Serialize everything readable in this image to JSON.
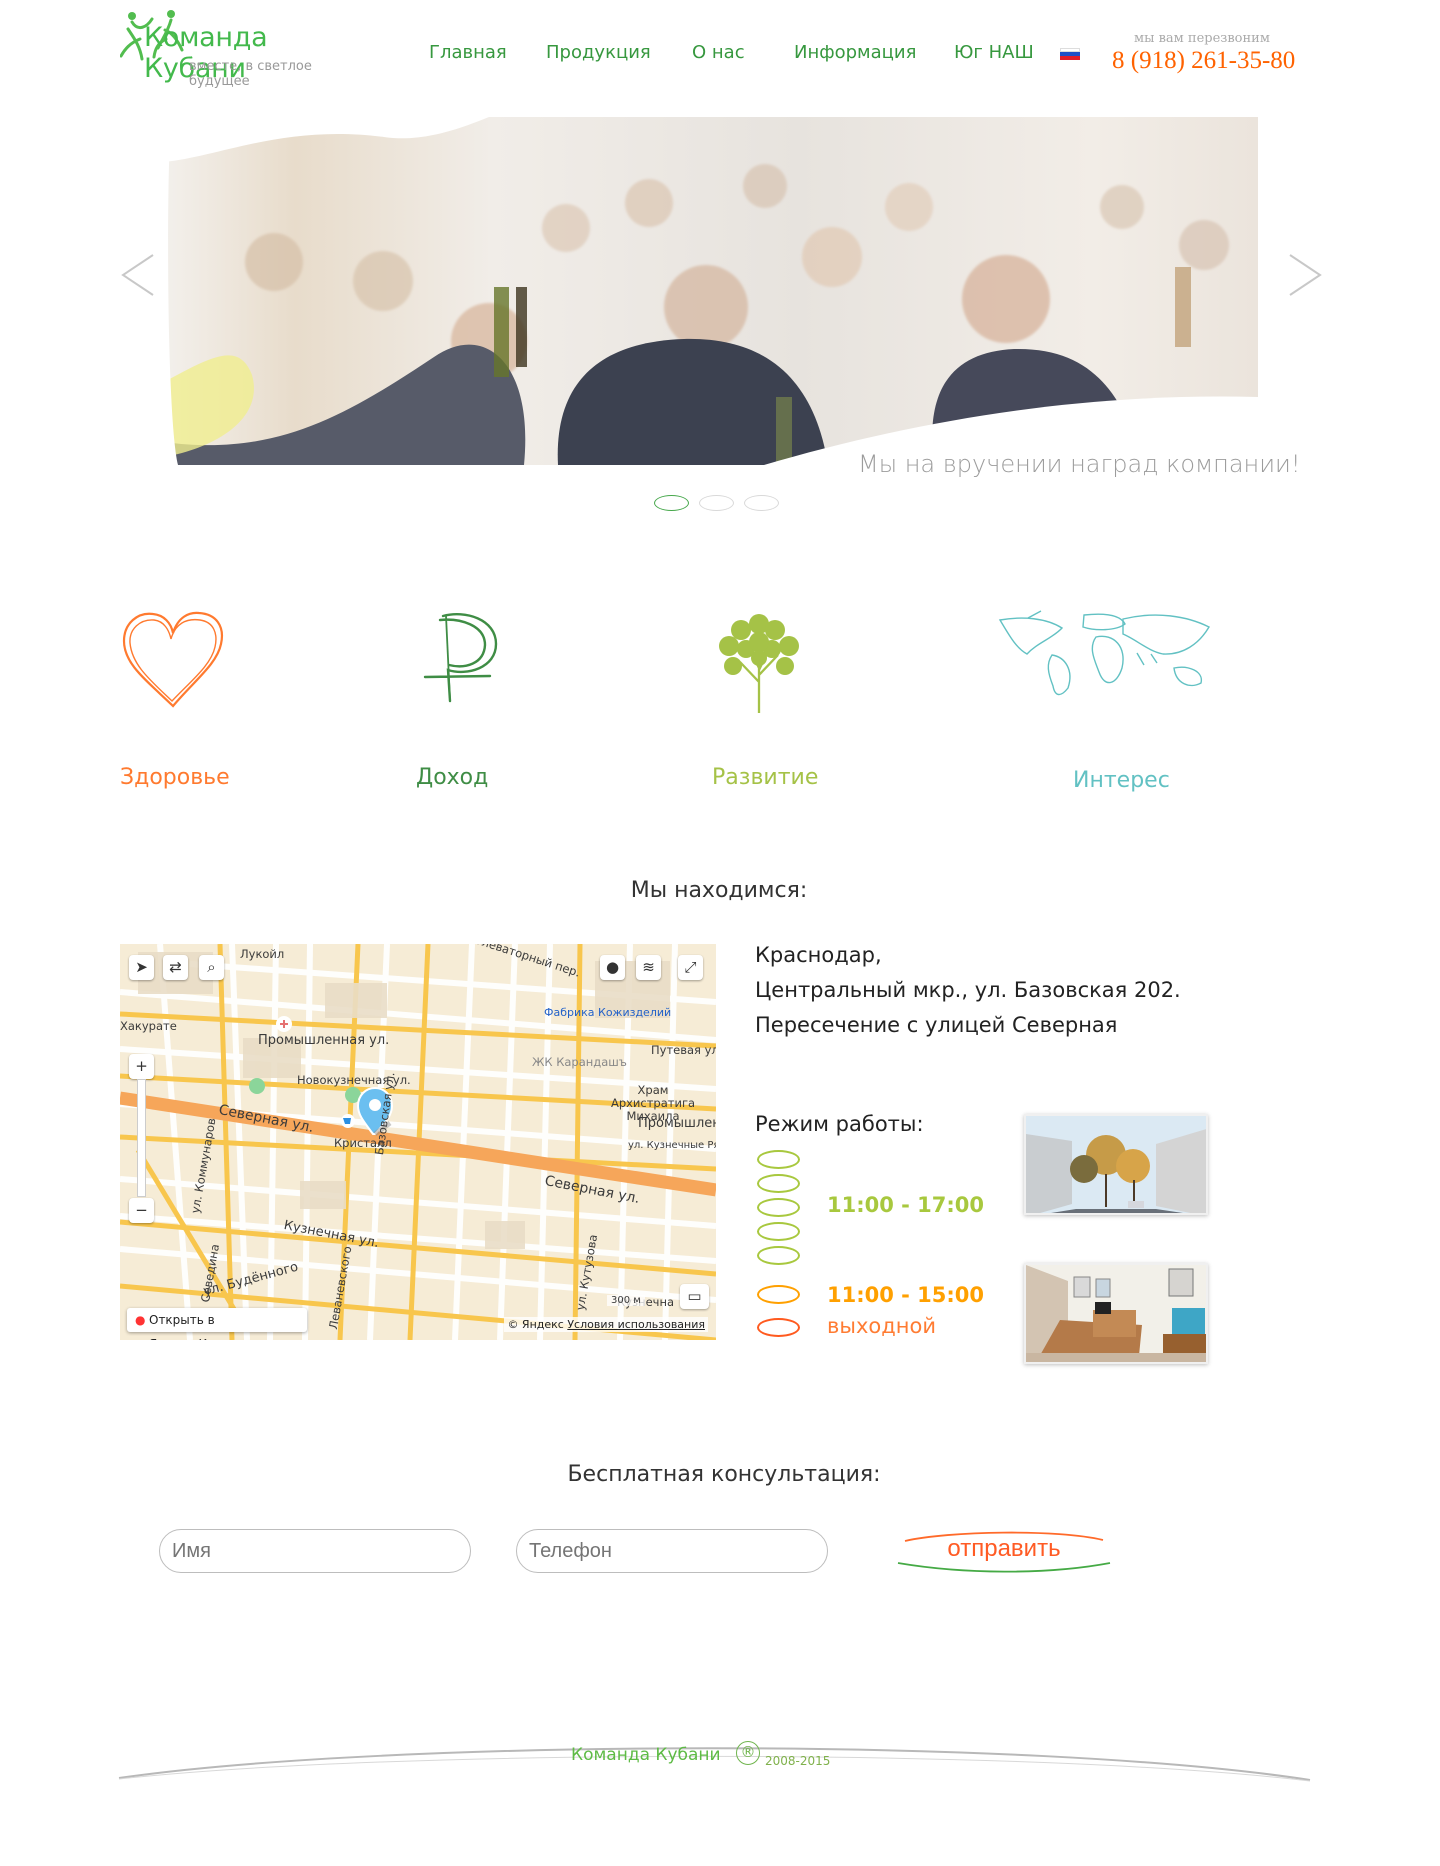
{
  "header": {
    "logo_name": "Команда Кубани",
    "logo_tagline": "вместе, в светлое будущее",
    "nav": [
      "Главная",
      "Продукция",
      "О нас",
      "Информация",
      "Юг НАШ"
    ],
    "callback_text": "мы вам перезвоним",
    "phone": "8 (918) 261-35-80"
  },
  "slider": {
    "caption": "Мы на вручении наград компании!",
    "slides_total": 3,
    "active_slide": 1
  },
  "features": [
    {
      "label": "Здоровье",
      "icon": "heart-icon",
      "color": "#ff7a2f"
    },
    {
      "label": "Доход",
      "icon": "ruble-icon",
      "color": "#3f8d45"
    },
    {
      "label": "Развитие",
      "icon": "tree-icon",
      "color": "#a5c247"
    },
    {
      "label": "Интерес",
      "icon": "world-map-icon",
      "color": "#62c1c3"
    }
  ],
  "location": {
    "title": "Мы находимся:",
    "address_lines": [
      "Краснодар,",
      "Центральный мкр., ул. Базовская 202.",
      "Пересечение с улицей Северная"
    ],
    "map": {
      "open_link": "Открыть в Яндекс.Картах",
      "copyright": "© Яндекс",
      "terms": "Условия использования",
      "scale": "300 м",
      "labels": [
        "Лукойл",
        "Хакурате",
        "Промышленная ул.",
        "Новокузнечная ул.",
        "Северная ул.",
        "Кристалл",
        "Базовская ул.",
        "Северная ул.",
        "Кузнечная ул.",
        "ул. Будённого",
        "Фабрика Кожизделий",
        "ЖК Карандашъ",
        "Путевая ул.",
        "Храм Архистратига Михаила",
        "Промышлен",
        "ул. Кузнечные Ря",
        "Леваневского",
        "ул. Кутузова",
        "ул. Коммунаров",
        "Севедина",
        "Кузнечна",
        "Элеваторный пер."
      ]
    }
  },
  "hours": {
    "title": "Режим работы:",
    "weekday": "11:00 - 17:00",
    "saturday": "11:00 - 15:00",
    "sunday": "выходной",
    "colors": {
      "weekday": "#a8c83e",
      "saturday": "#ffa000",
      "sunday": "#ff5a1f"
    }
  },
  "consultation": {
    "title": "Бесплатная консультация:",
    "name_placeholder": "Имя",
    "phone_placeholder": "Телефон",
    "submit_label": "отправить"
  },
  "footer": {
    "logo_name": "Команда Кубани",
    "registered": "®",
    "years": "2008-2015"
  }
}
